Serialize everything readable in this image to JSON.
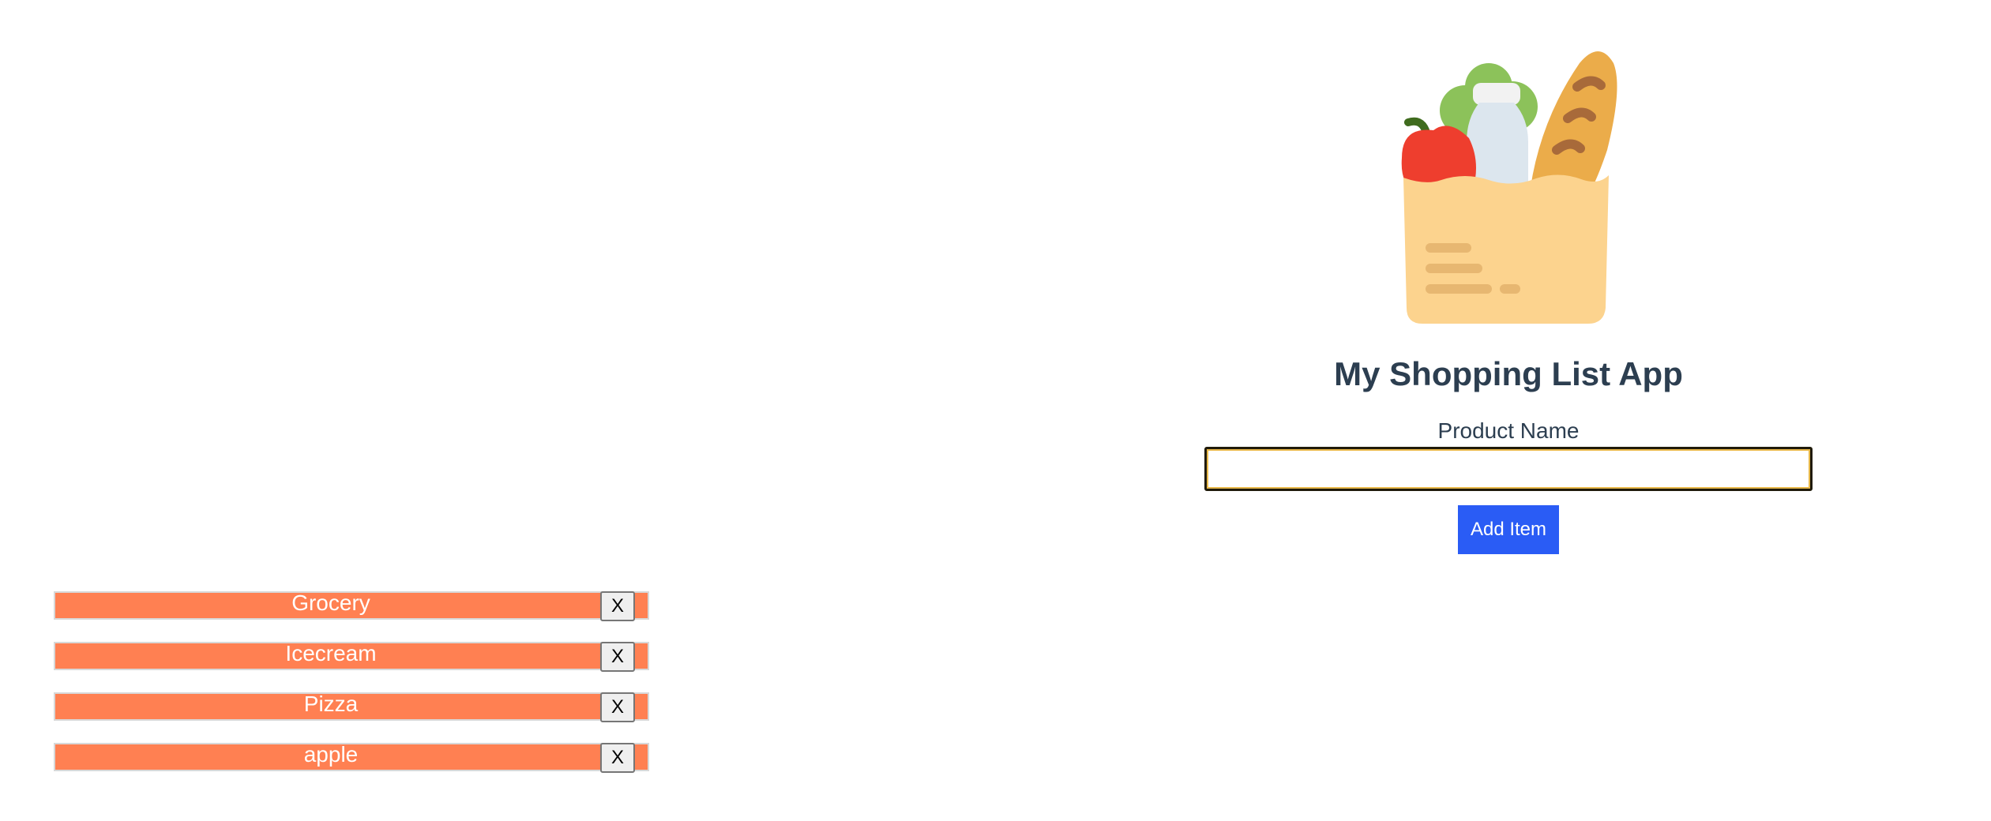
{
  "app": {
    "title": "My Shopping List App",
    "logo_icon": "grocery-bag-icon"
  },
  "form": {
    "label": "Product Name",
    "input_value": "",
    "input_placeholder": "",
    "add_button_label": "Add Item"
  },
  "items": [
    {
      "label": "Grocery",
      "remove_label": "X"
    },
    {
      "label": "Icecream",
      "remove_label": "X"
    },
    {
      "label": "Pizza",
      "remove_label": "X"
    },
    {
      "label": "apple",
      "remove_label": "X"
    }
  ],
  "colors": {
    "title_text": "#2c3e50",
    "add_button_bg": "#2a5cf5",
    "list_item_bg": "#ff8052",
    "list_item_text": "#ffffff",
    "input_focus_ring": "#e8b84a"
  }
}
